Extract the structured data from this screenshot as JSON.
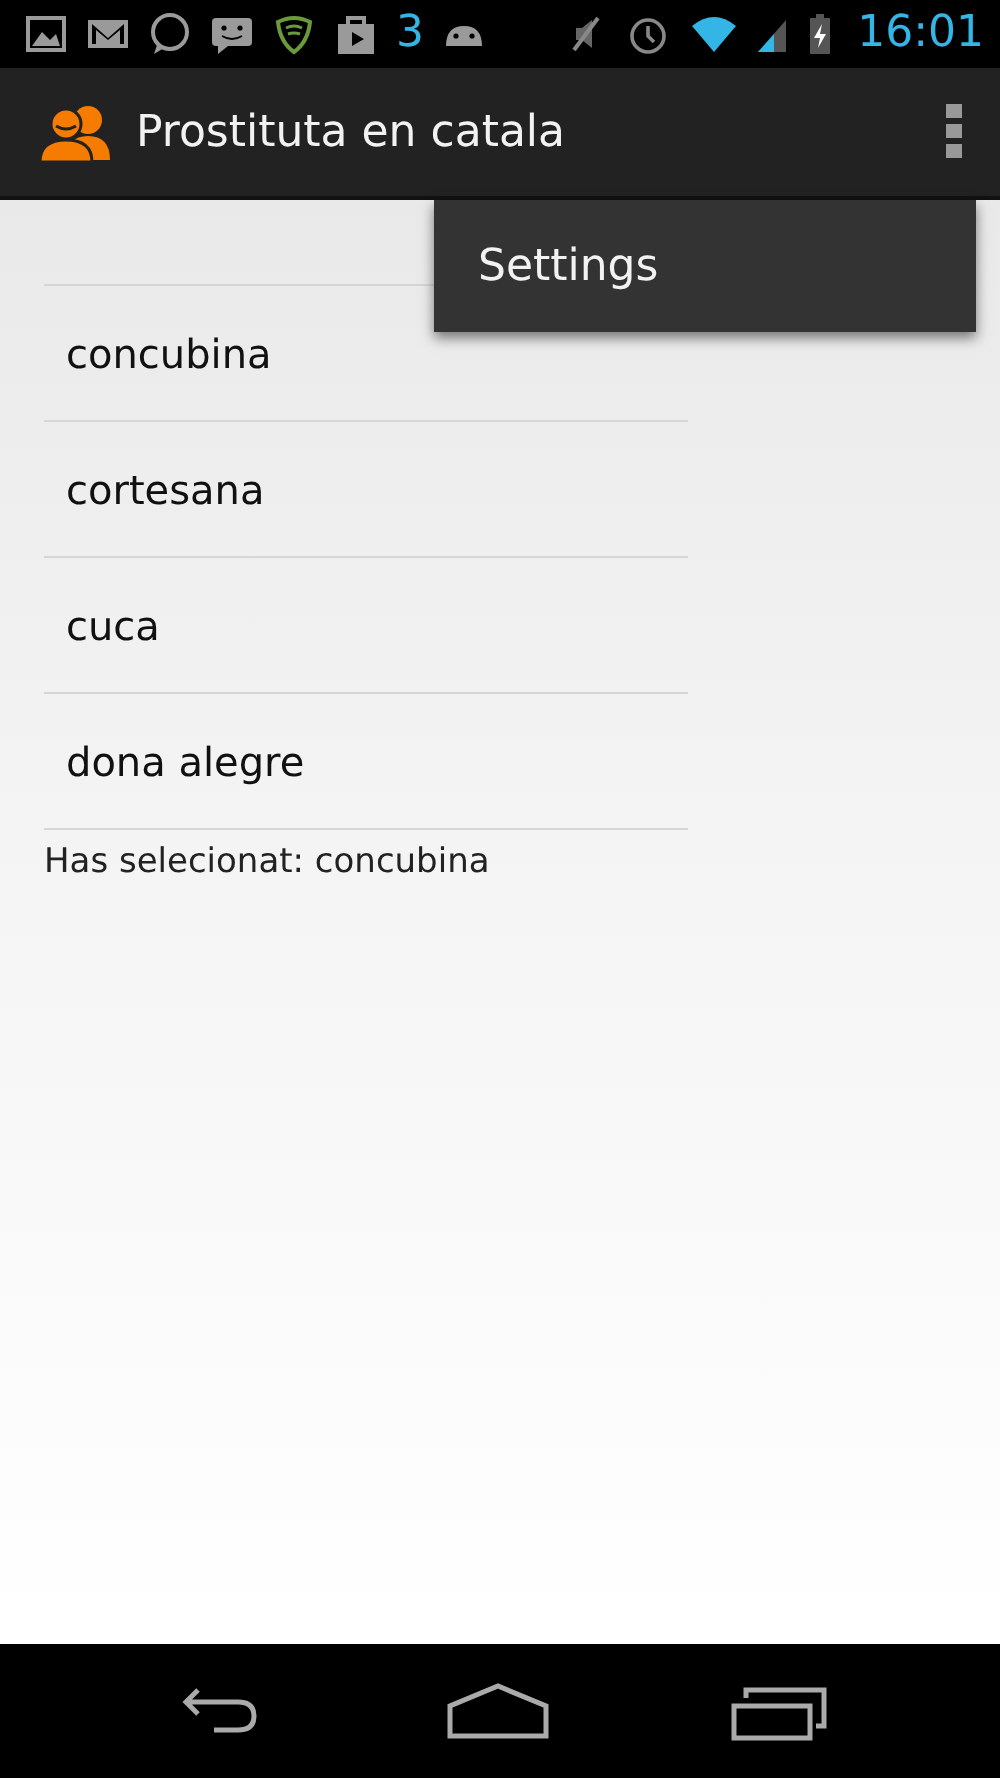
{
  "status_bar": {
    "notification_count": "3",
    "time": "16:01"
  },
  "action_bar": {
    "title": "Prostituta en catala"
  },
  "overflow_menu": {
    "items": [
      "Settings"
    ]
  },
  "list": {
    "items": [
      "concubina",
      "cortesana",
      "cuca",
      "dona alegre"
    ]
  },
  "selection_text": "Has selecionat: concubina"
}
